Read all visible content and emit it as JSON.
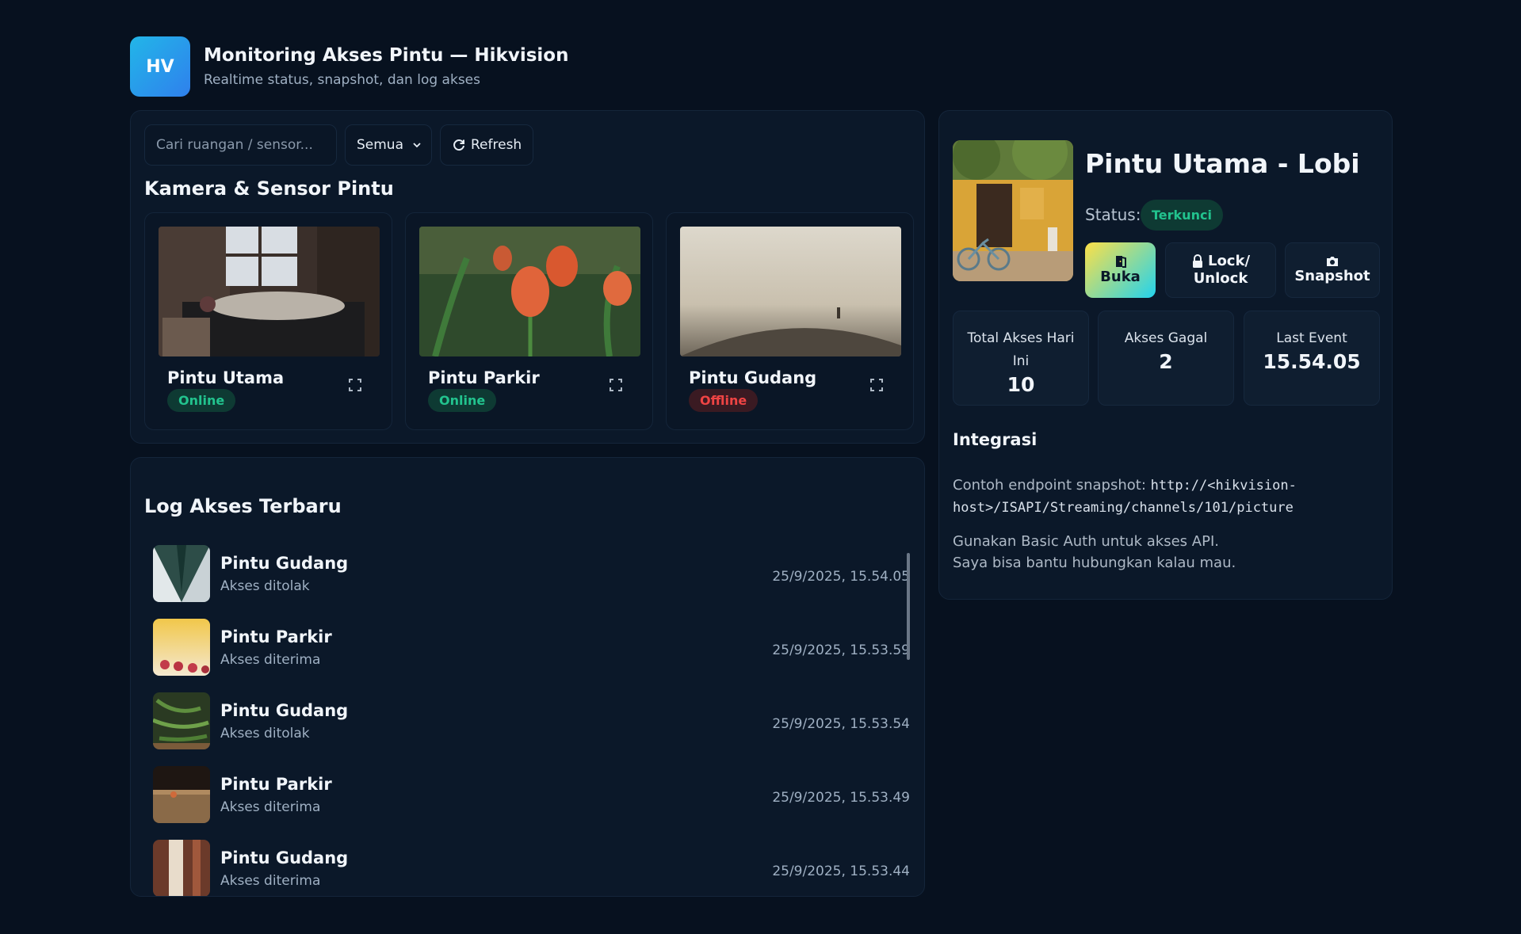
{
  "header": {
    "logo_text": "HV",
    "title": "Monitoring Akses Pintu — Hikvision",
    "subtitle": "Realtime status, snapshot, dan log akses"
  },
  "toolbar": {
    "search_placeholder": "Cari ruangan / sensor...",
    "filter_value": "Semua",
    "refresh_label": "Refresh"
  },
  "cameras": {
    "section_title": "Kamera & Sensor Pintu",
    "items": [
      {
        "name": "Pintu Utama",
        "status": "Online"
      },
      {
        "name": "Pintu Parkir",
        "status": "Online"
      },
      {
        "name": "Pintu Gudang",
        "status": "Offline"
      }
    ]
  },
  "log": {
    "section_title": "Log Akses Terbaru",
    "items": [
      {
        "door": "Pintu Gudang",
        "status": "Akses ditolak",
        "time": "25/9/2025, 15.54.05"
      },
      {
        "door": "Pintu Parkir",
        "status": "Akses diterima",
        "time": "25/9/2025, 15.53.59"
      },
      {
        "door": "Pintu Gudang",
        "status": "Akses ditolak",
        "time": "25/9/2025, 15.53.54"
      },
      {
        "door": "Pintu Parkir",
        "status": "Akses diterima",
        "time": "25/9/2025, 15.53.49"
      },
      {
        "door": "Pintu Gudang",
        "status": "Akses diterima",
        "time": "25/9/2025, 15.53.44"
      }
    ]
  },
  "detail": {
    "title": "Pintu Utama - Lobi",
    "status_label": "Status:",
    "status_value": "Terkunci",
    "actions": {
      "open": "Buka",
      "lock_line1": "Lock/",
      "lock_line2": "Unlock",
      "snapshot": "Snapshot"
    },
    "stats": {
      "total_label": "Total Akses Hari Ini",
      "total_value": "10",
      "failed_label": "Akses Gagal",
      "failed_value": "2",
      "last_label": "Last Event",
      "last_value": "15.54.05"
    },
    "integration": {
      "title": "Integrasi",
      "endpoint_prefix": "Contoh endpoint snapshot:",
      "endpoint_code": "http://<hikvision-host>/ISAPI/Streaming/channels/101/picture",
      "note_line1": "Gunakan Basic Auth untuk akses API.",
      "note_line2": "Saya bisa bantu hubungkan kalau mau."
    }
  }
}
